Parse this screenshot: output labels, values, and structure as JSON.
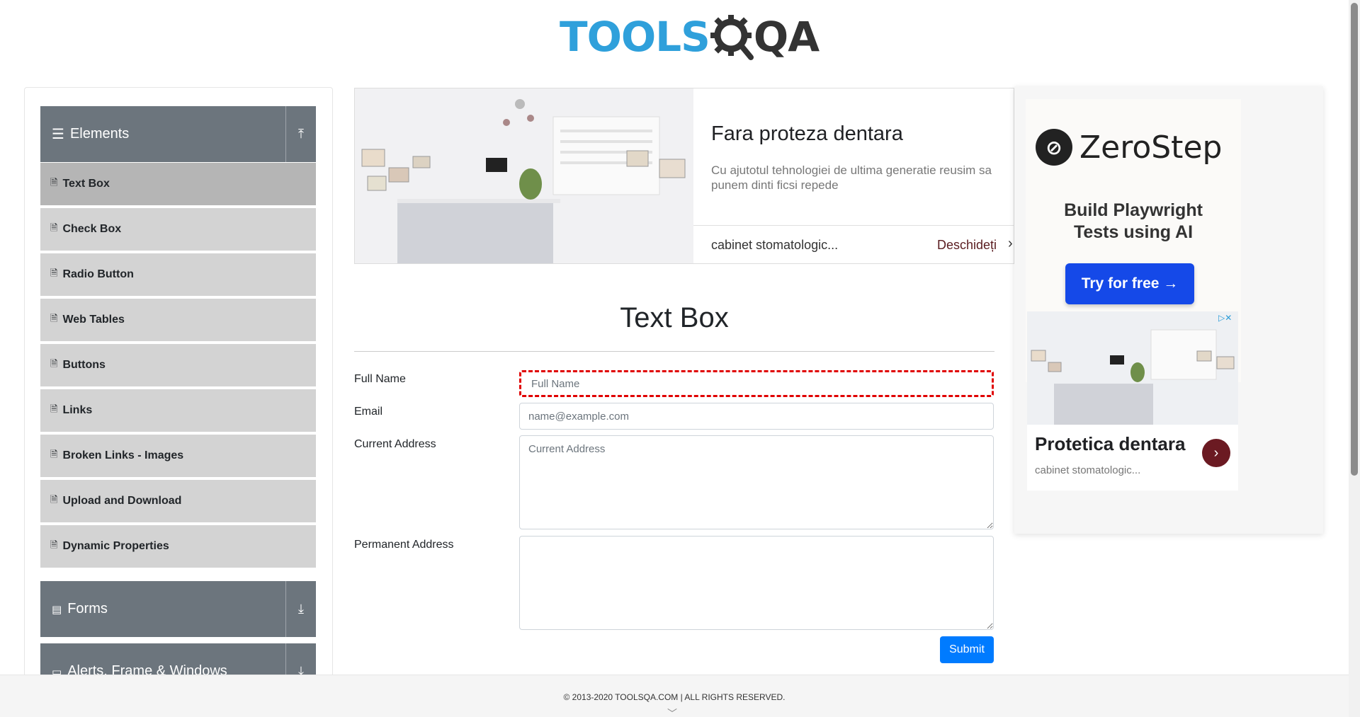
{
  "brand": {
    "logo_tools": "TOOLS",
    "logo_qa": "QA"
  },
  "sidebar": {
    "groups": [
      {
        "label": "Elements",
        "icon": "hamburger-icon",
        "toggle": "arrow-up-icon"
      },
      {
        "label": "Forms",
        "icon": "document-icon",
        "toggle": "arrow-down-icon"
      },
      {
        "label": "Alerts, Frame & Windows",
        "icon": "window-icon",
        "toggle": "arrow-down-icon"
      }
    ],
    "items": [
      {
        "label": "Text Box",
        "active": true
      },
      {
        "label": "Check Box"
      },
      {
        "label": "Radio Button"
      },
      {
        "label": "Web Tables"
      },
      {
        "label": "Buttons"
      },
      {
        "label": "Links"
      },
      {
        "label": "Broken Links - Images"
      },
      {
        "label": "Upload and Download"
      },
      {
        "label": "Dynamic Properties"
      }
    ],
    "item_icon": "file-icon"
  },
  "ad_banner": {
    "title": "Fara proteza dentara",
    "description": "Cu ajutotul tehnologiei de ultima generatie reusim sa punem dinti ficsi repede",
    "source": "cabinet stomatologic...",
    "open_label": "Deschideți",
    "chevron": "›"
  },
  "form": {
    "title": "Text Box",
    "full_name_label": "Full Name",
    "full_name_placeholder": "Full Name",
    "email_label": "Email",
    "email_placeholder": "name@example.com",
    "current_address_label": "Current Address",
    "current_address_placeholder": "Current Address",
    "permanent_address_label": "Permanent Address",
    "submit_label": "Submit",
    "error_color": "#e00000",
    "accent": "#007bff"
  },
  "ad_right": {
    "brand": "ZeroStep",
    "tagline_line1": "Build Playwright",
    "tagline_line2": "Tests using AI",
    "cta": "Try for free →",
    "adchoices": "▷✕",
    "promo_title": "Protetica dentara",
    "promo_source": "cabinet stomatologic...",
    "promo_arrow": "›"
  },
  "footer": {
    "text": "© 2013-2020 TOOLSQA.COM | ALL RIGHTS RESERVED."
  }
}
